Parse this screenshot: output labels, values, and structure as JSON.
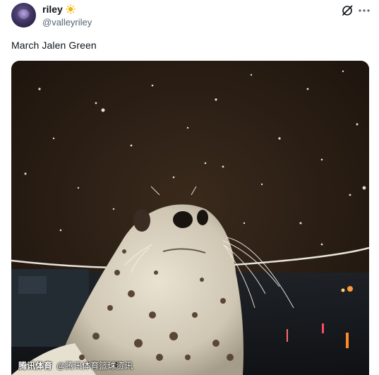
{
  "author": {
    "display_name": "riley",
    "handle": "@valleyriley",
    "name_emoji_icon": "sun-icon",
    "avatar_icon": "avatar"
  },
  "header_actions": {
    "grok_icon": "grok-icon",
    "more_icon": "more-icon"
  },
  "tweet": {
    "text": "March Jalen Green"
  },
  "media": {
    "type": "video",
    "watermark_brand": "腾讯体育",
    "watermark_handle": "@腾讯体育篮球资讯"
  },
  "colors": {
    "text_primary": "#0f1419",
    "text_secondary": "#536471",
    "sun": "#f4b400",
    "media_background": "#251a12"
  }
}
